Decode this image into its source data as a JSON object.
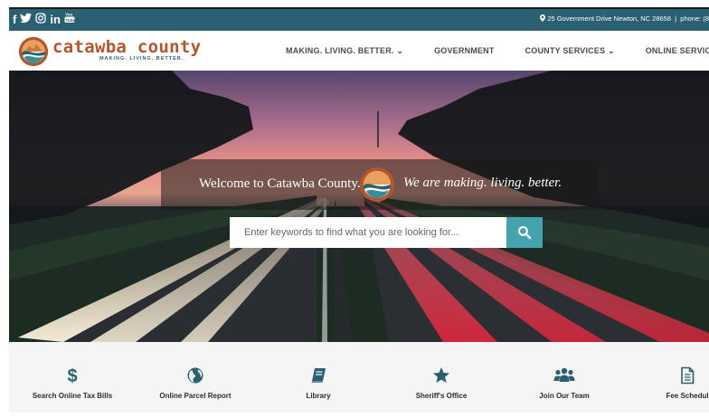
{
  "topbar": {
    "social": [
      {
        "glyph": "f",
        "icon": "facebook-icon"
      },
      {
        "glyph": "🐦",
        "icon": "twitter-icon"
      },
      {
        "glyph": "◎",
        "icon": "instagram-icon"
      },
      {
        "glyph": "in",
        "icon": "linkedin-icon"
      },
      {
        "glyph": "▶",
        "icon": "youtube-icon"
      }
    ],
    "address": "25 Government Drive Newton, NC 28658",
    "separator": "|",
    "phone": "phone: (8"
  },
  "nav": {
    "brand": "catawba county",
    "tagline": "MAKING. LIVING. BETTER.",
    "menu": [
      {
        "label": "MAKING. LIVING. BETTER.",
        "dropdown": "⌄"
      },
      {
        "label": "GOVERNMENT",
        "dropdown": ""
      },
      {
        "label": "COUNTY SERVICES",
        "dropdown": "⌄"
      },
      {
        "label": "ONLINE SERVICES",
        "dropdown": "⌄"
      }
    ]
  },
  "hero": {
    "welcome": "Welcome to Catawba County.",
    "tagline": "We are making. living. better.",
    "search_placeholder": "Enter keywords to find what you are looking for..."
  },
  "quick_links": [
    {
      "label": "Search Online Tax Bills",
      "icon": "dollar-icon"
    },
    {
      "label": "Online Parcel Report",
      "icon": "globe-icon"
    },
    {
      "label": "Library",
      "icon": "book-icon"
    },
    {
      "label": "Sheriff's Office",
      "icon": "star-icon"
    },
    {
      "label": "Join Our Team",
      "icon": "users-icon"
    },
    {
      "label": "Fee Schedul",
      "icon": "document-icon"
    }
  ],
  "colors": {
    "topbar": "#2a6071",
    "brand": "#b4562c",
    "accent": "#45a3ad",
    "icon": "#2a6071"
  }
}
